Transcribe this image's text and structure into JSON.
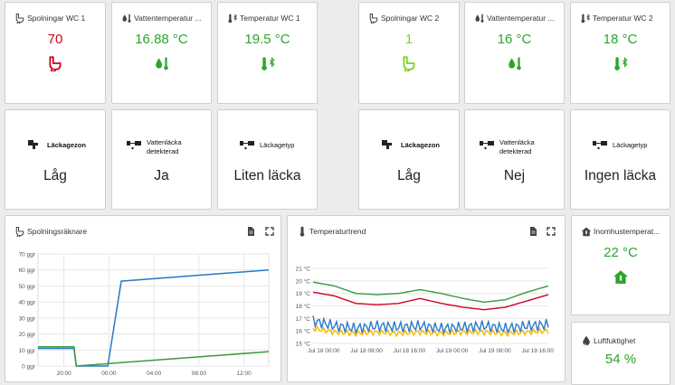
{
  "wc1": {
    "flushes": {
      "title": "Spolningar WC 1",
      "value": "70",
      "color": "#d0021b"
    },
    "water_temp": {
      "title": "Vattentemperatur ...",
      "value": "16.88 °C",
      "color": "#2ba52b"
    },
    "temp": {
      "title": "Temperatur WC 1",
      "value": "19.5 °C",
      "color": "#2ba52b"
    },
    "leak_zone": {
      "label": "Läckagezon",
      "value": "Låg"
    },
    "leak_detected": {
      "label": "Vattenläcka detekterad",
      "value": "Ja"
    },
    "leak_type": {
      "label": "Läckagetyp",
      "value": "Liten läcka"
    }
  },
  "wc2": {
    "flushes": {
      "title": "Spolningar WC 2",
      "value": "1",
      "color": "#7ed321"
    },
    "water_temp": {
      "title": "Vattentemperatur ...",
      "value": "16 °C",
      "color": "#2ba52b"
    },
    "temp": {
      "title": "Temperatur WC 2",
      "value": "18 °C",
      "color": "#2ba52b"
    },
    "leak_zone": {
      "label": "Läckagezon",
      "value": "Låg"
    },
    "leak_detected": {
      "label": "Vattenläcka detekterad",
      "value": "Nej"
    },
    "leak_type": {
      "label": "Läckagetyp",
      "value": "Ingen läcka"
    }
  },
  "indoor_temp": {
    "title": "Inomhustemperat...",
    "value": "22 °C",
    "color": "#2ba52b"
  },
  "humidity": {
    "title": "Luftfuktighet",
    "value": "54 %",
    "color": "#2ba52b"
  },
  "icons": [
    "toilet-icon",
    "water-drop-thermometer-icon",
    "thermometer-bluetooth-icon",
    "pipe-leak-icon",
    "document-icon",
    "fullscreen-icon",
    "house-thermometer-icon",
    "humidity-icon"
  ],
  "flush_chart": {
    "title": "Spolningsräknare",
    "chart_data": {
      "type": "line",
      "x_ticks": [
        "20:00",
        "00:00",
        "04:00",
        "08:00",
        "12:00"
      ],
      "y_ticks": [
        "0 ggr",
        "10 ggr",
        "20 ggr",
        "30 ggr",
        "40 ggr",
        "50 ggr",
        "60 ggr",
        "70 ggr"
      ],
      "ylim": [
        0,
        70
      ],
      "xlim": [
        17.7,
        38.2
      ],
      "series": [
        {
          "color": "#2979c9",
          "x": [
            17.7,
            20.9,
            21.1,
            23.9,
            25.1,
            38.2
          ],
          "y": [
            11,
            11,
            0,
            0,
            53,
            60
          ]
        },
        {
          "color": "#3a9a3a",
          "x": [
            17.7,
            20.9,
            21.1,
            38.2
          ],
          "y": [
            12,
            12,
            0,
            9
          ]
        }
      ]
    }
  },
  "temp_chart": {
    "title": "Temperaturtrend",
    "chart_data": {
      "type": "line",
      "x_ticks": [
        "Jul 18 00:00",
        "Jul 18 08:00",
        "Jul 18 16:00",
        "Jul 19 00:00",
        "Jul 19 08:00",
        "Jul 19 16:00"
      ],
      "y_ticks": [
        "15 °C",
        "16 °C",
        "17 °C",
        "18 °C",
        "19 °C",
        "20 °C",
        "21 °C"
      ],
      "ylim": [
        15,
        21
      ],
      "xlim": [
        -2,
        42
      ],
      "series": [
        {
          "color": "#3a9a3a",
          "x": [
            -2,
            2,
            6,
            10,
            14,
            18,
            22,
            26,
            30,
            34,
            38,
            42
          ],
          "y": [
            19.9,
            19.6,
            19.0,
            18.9,
            19.0,
            19.3,
            19.0,
            18.6,
            18.3,
            18.5,
            19.1,
            19.6
          ]
        },
        {
          "color": "#d0021b",
          "x": [
            -2,
            2,
            6,
            10,
            14,
            18,
            22,
            26,
            30,
            34,
            38,
            42
          ],
          "y": [
            19.1,
            18.8,
            18.2,
            18.1,
            18.2,
            18.6,
            18.2,
            17.9,
            17.7,
            17.9,
            18.4,
            18.9
          ]
        },
        {
          "color": "#2979c9",
          "x": [
            -2,
            2,
            6,
            10,
            14,
            18,
            22,
            26,
            30,
            34,
            38,
            42
          ],
          "y": [
            16.8,
            16.4,
            16.2,
            16.4,
            16.3,
            16.4,
            16.2,
            16.3,
            16.4,
            16.2,
            16.4,
            16.5
          ]
        },
        {
          "color": "#f5b800",
          "x": [
            -2,
            2,
            6,
            10,
            14,
            18,
            22,
            26,
            30,
            34,
            38,
            42
          ],
          "y": [
            16.2,
            15.9,
            15.8,
            15.9,
            15.8,
            15.9,
            15.8,
            15.9,
            15.9,
            15.8,
            15.9,
            16.0
          ]
        }
      ]
    }
  }
}
